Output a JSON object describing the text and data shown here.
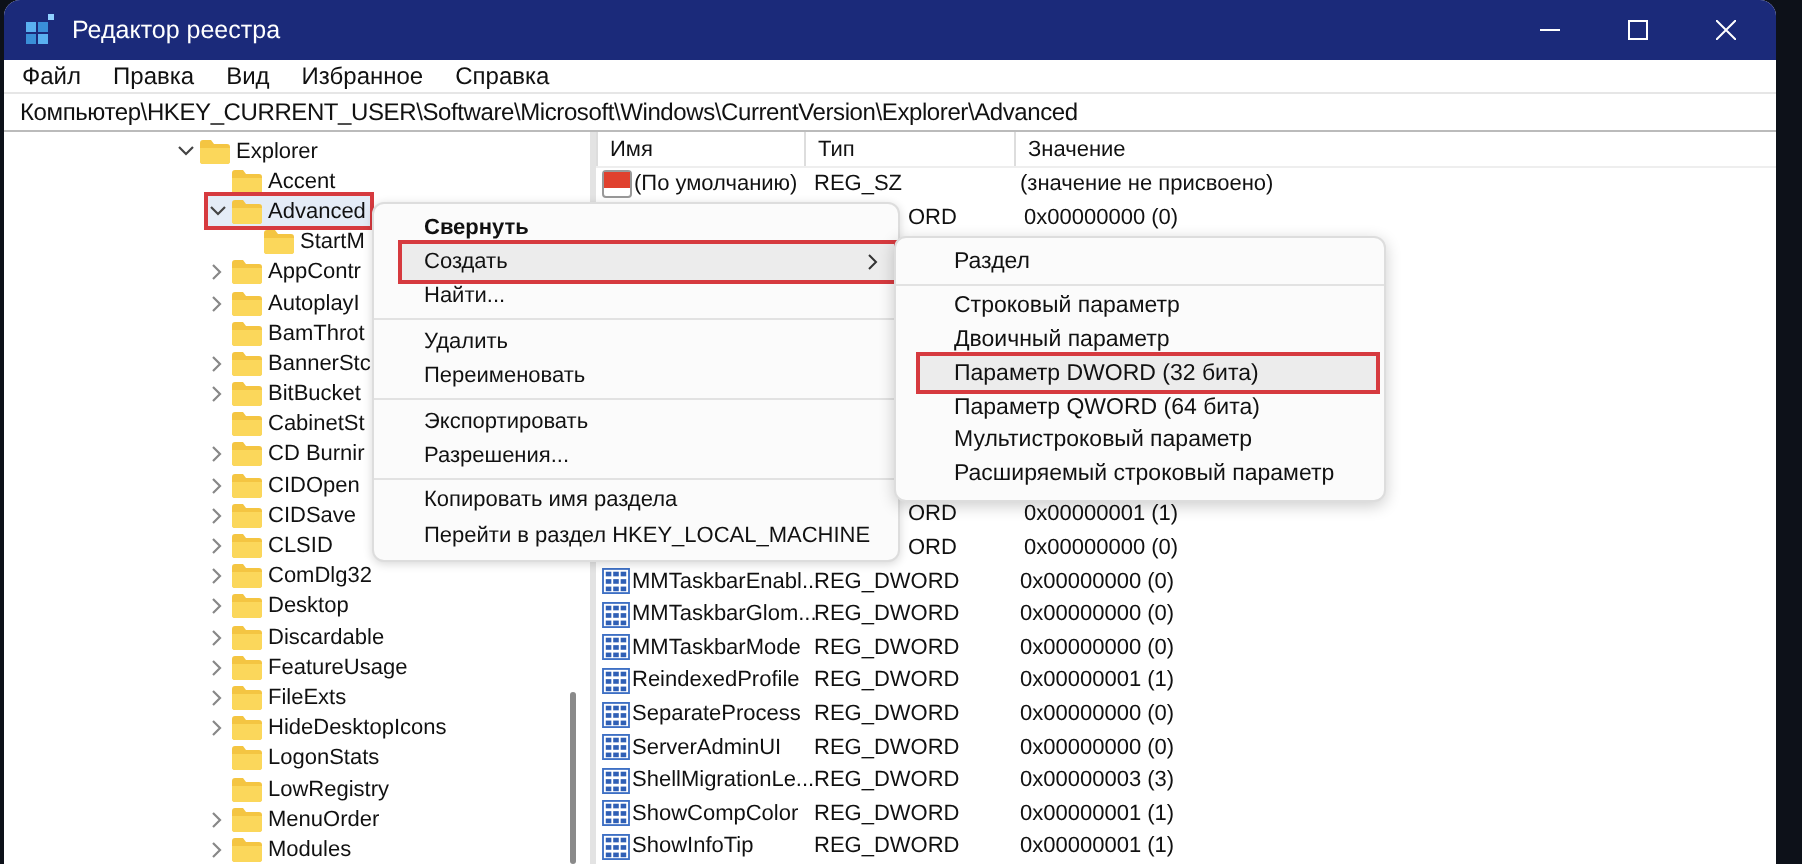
{
  "window": {
    "title": "Редактор реестра"
  },
  "menu_bar": [
    "Файл",
    "Правка",
    "Вид",
    "Избранное",
    "Справка"
  ],
  "address": "Компьютер\\HKEY_CURRENT_USER\\Software\\Microsoft\\Windows\\CurrentVersion\\Explorer\\Advanced",
  "tree": [
    {
      "label": "Explorer",
      "has_children": true,
      "expanded": true,
      "selected": false,
      "highlighted": false,
      "children": [
        {
          "label": "Accent",
          "has_children": false,
          "selected": false,
          "highlighted": false
        },
        {
          "label": "Advanced",
          "has_children": true,
          "expanded": true,
          "selected": true,
          "highlighted": true,
          "children": [
            {
              "label": "StartM",
              "has_children": false,
              "selected": false,
              "highlighted": false
            }
          ]
        },
        {
          "label": "AppContr",
          "has_children": true,
          "expanded": false,
          "selected": false,
          "highlighted": false
        },
        {
          "label": "AutoplayI",
          "has_children": true,
          "expanded": false,
          "selected": false,
          "highlighted": false
        },
        {
          "label": "BamThrot",
          "has_children": false,
          "selected": false,
          "highlighted": false
        },
        {
          "label": "BannerStc",
          "has_children": true,
          "expanded": false,
          "selected": false,
          "highlighted": false
        },
        {
          "label": "BitBucket",
          "has_children": true,
          "expanded": false,
          "selected": false,
          "highlighted": false
        },
        {
          "label": "CabinetSt",
          "has_children": false,
          "selected": false,
          "highlighted": false
        },
        {
          "label": "CD Burnir",
          "has_children": true,
          "expanded": false,
          "selected": false,
          "highlighted": false
        },
        {
          "label": "CIDOpen",
          "has_children": true,
          "expanded": false,
          "selected": false,
          "highlighted": false
        },
        {
          "label": "CIDSave",
          "has_children": true,
          "expanded": false,
          "selected": false,
          "highlighted": false
        },
        {
          "label": "CLSID",
          "has_children": true,
          "expanded": false,
          "selected": false,
          "highlighted": false
        },
        {
          "label": "ComDlg32",
          "has_children": true,
          "expanded": false,
          "selected": false,
          "highlighted": false
        },
        {
          "label": "Desktop",
          "has_children": true,
          "expanded": false,
          "selected": false,
          "highlighted": false
        },
        {
          "label": "Discardable",
          "has_children": true,
          "expanded": false,
          "selected": false,
          "highlighted": false
        },
        {
          "label": "FeatureUsage",
          "has_children": true,
          "expanded": false,
          "selected": false,
          "highlighted": false
        },
        {
          "label": "FileExts",
          "has_children": true,
          "expanded": false,
          "selected": false,
          "highlighted": false
        },
        {
          "label": "HideDesktopIcons",
          "has_children": true,
          "expanded": false,
          "selected": false,
          "highlighted": false
        },
        {
          "label": "LogonStats",
          "has_children": false,
          "selected": false,
          "highlighted": false
        },
        {
          "label": "LowRegistry",
          "has_children": false,
          "selected": false,
          "highlighted": false
        },
        {
          "label": "MenuOrder",
          "has_children": true,
          "expanded": false,
          "selected": false,
          "highlighted": false
        },
        {
          "label": "Modules",
          "has_children": true,
          "expanded": false,
          "selected": false,
          "highlighted": false
        }
      ]
    }
  ],
  "list": {
    "columns": [
      "Имя",
      "Тип",
      "Значение"
    ],
    "rows_top": [
      {
        "kind": "string",
        "name": "(По умолчанию)",
        "type": "REG_SZ",
        "value": "(значение не присвоено)"
      },
      {
        "kind": "partial",
        "type": "ORD",
        "value": "0x00000000 (0)"
      }
    ],
    "rows_bottom": [
      {
        "kind": "partial",
        "type": "ORD",
        "value": "0x00000001 (1)"
      },
      {
        "kind": "partial",
        "type": "ORD",
        "value": "0x00000000 (0)"
      },
      {
        "kind": "dword",
        "name": "MMTaskbarEnabl...",
        "type": "REG_DWORD",
        "value": "0x00000000 (0)"
      },
      {
        "kind": "dword",
        "name": "MMTaskbarGlom...",
        "type": "REG_DWORD",
        "value": "0x00000000 (0)"
      },
      {
        "kind": "dword",
        "name": "MMTaskbarMode",
        "type": "REG_DWORD",
        "value": "0x00000000 (0)"
      },
      {
        "kind": "dword",
        "name": "ReindexedProfile",
        "type": "REG_DWORD",
        "value": "0x00000001 (1)"
      },
      {
        "kind": "dword",
        "name": "SeparateProcess",
        "type": "REG_DWORD",
        "value": "0x00000000 (0)"
      },
      {
        "kind": "dword",
        "name": "ServerAdminUI",
        "type": "REG_DWORD",
        "value": "0x00000000 (0)"
      },
      {
        "kind": "dword",
        "name": "ShellMigrationLe...",
        "type": "REG_DWORD",
        "value": "0x00000003 (3)"
      },
      {
        "kind": "dword",
        "name": "ShowCompColor",
        "type": "REG_DWORD",
        "value": "0x00000001 (1)"
      },
      {
        "kind": "dword",
        "name": "ShowInfoTip",
        "type": "REG_DWORD",
        "value": "0x00000001 (1)"
      }
    ]
  },
  "context_menu": {
    "items": [
      {
        "kind": "item",
        "label": "Свернуть",
        "bold": true,
        "submenu": false,
        "highlighted": false
      },
      {
        "kind": "item",
        "label": "Создать",
        "bold": false,
        "submenu": true,
        "highlighted": true
      },
      {
        "kind": "item",
        "label": "Найти...",
        "bold": false,
        "submenu": false,
        "highlighted": false
      },
      {
        "kind": "separator"
      },
      {
        "kind": "item",
        "label": "Удалить",
        "bold": false,
        "submenu": false,
        "highlighted": false
      },
      {
        "kind": "item",
        "label": "Переименовать",
        "bold": false,
        "submenu": false,
        "highlighted": false
      },
      {
        "kind": "separator"
      },
      {
        "kind": "item",
        "label": "Экспортировать",
        "bold": false,
        "submenu": false,
        "highlighted": false
      },
      {
        "kind": "item",
        "label": "Разрешения...",
        "bold": false,
        "submenu": false,
        "highlighted": false
      },
      {
        "kind": "separator"
      },
      {
        "kind": "item",
        "label": "Копировать имя раздела",
        "bold": false,
        "submenu": false,
        "highlighted": false
      },
      {
        "kind": "item",
        "label": "Перейти в раздел HKEY_LOCAL_MACHINE",
        "bold": false,
        "submenu": false,
        "highlighted": false
      }
    ]
  },
  "submenu": {
    "items": [
      {
        "kind": "item",
        "label": "Раздел",
        "highlighted": false
      },
      {
        "kind": "separator"
      },
      {
        "kind": "item",
        "label": "Строковый параметр",
        "highlighted": false
      },
      {
        "kind": "item",
        "label": "Двоичный параметр",
        "highlighted": false
      },
      {
        "kind": "item",
        "label": "Параметр DWORD (32 бита)",
        "highlighted": true
      },
      {
        "kind": "item",
        "label": "Параметр QWORD (64 бита)",
        "highlighted": false
      },
      {
        "kind": "item",
        "label": "Мультистроковый параметр",
        "highlighted": false
      },
      {
        "kind": "item",
        "label": "Расширяемый строковый параметр",
        "highlighted": false
      }
    ]
  }
}
